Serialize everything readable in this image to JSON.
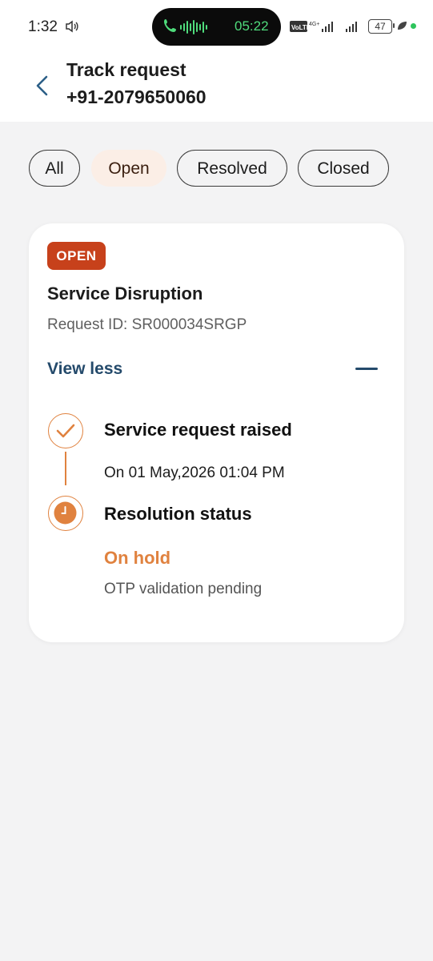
{
  "status_bar": {
    "time": "1:32",
    "call_timer": "05:22",
    "battery": "47",
    "icons": [
      "volume-icon",
      "phone-icon",
      "voice-wave-icon",
      "volte-icon",
      "signal-icon",
      "battery-icon",
      "leaf-icon"
    ],
    "call_color": "#4fdc7c"
  },
  "header": {
    "title": "Track request",
    "subtitle": "+91-2079650060",
    "back_icon": "chevron-left-icon"
  },
  "filters": {
    "chips": [
      {
        "label": "All",
        "active": false
      },
      {
        "label": "Open",
        "active": true
      },
      {
        "label": "Resolved",
        "active": false
      },
      {
        "label": "Closed",
        "active": false
      }
    ]
  },
  "request": {
    "badge": "OPEN",
    "badge_color": "#c7411b",
    "title": "Service Disruption",
    "request_id": "Request ID: SR000034SRGP",
    "toggle_label": "View less",
    "accent_color": "#e0823f",
    "link_color": "#244a6b",
    "timeline": [
      {
        "title": "Service request raised",
        "detail": "On 01 May,2026 01:04 PM",
        "icon": "check-icon"
      },
      {
        "title": "Resolution status",
        "status": "On hold",
        "detail": "OTP validation pending",
        "icon": "clock-icon"
      }
    ]
  }
}
